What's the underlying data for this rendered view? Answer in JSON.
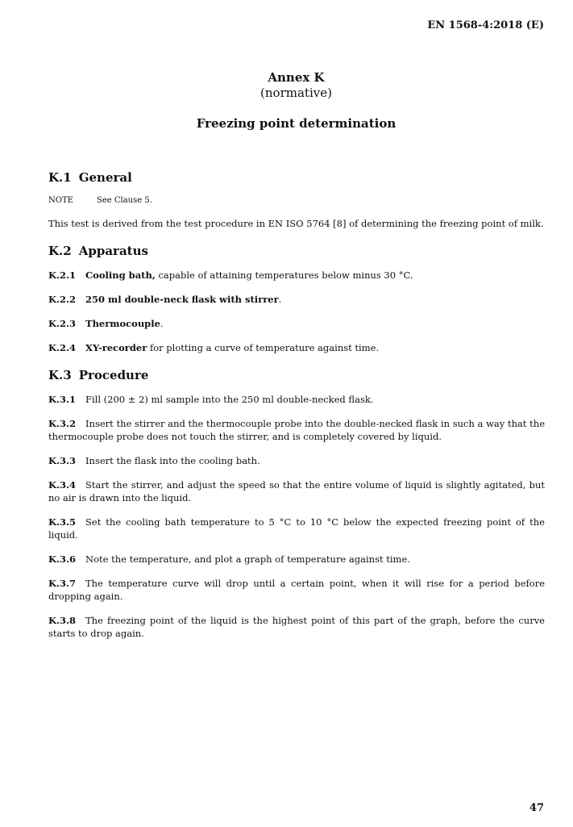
{
  "header": {
    "document_id": "EN 1568-4:2018 (E)"
  },
  "annex": {
    "title": "Annex K",
    "kind": "(normative)",
    "subject": "Freezing point determination"
  },
  "sections": {
    "general": {
      "num": "K.1",
      "title": "General",
      "note_label": "NOTE",
      "note_text": "See Clause 5.",
      "body": "This test is derived from the test procedure in EN ISO 5764 [8] of determining the freezing point of milk."
    },
    "apparatus": {
      "num": "K.2",
      "title": "Apparatus",
      "items": [
        {
          "num": "K.2.1",
          "bold": "Cooling bath,",
          "rest": " capable of attaining temperatures below minus 30 °C."
        },
        {
          "num": "K.2.2",
          "bold": "250 ml double-neck flask with stirrer",
          "rest": "."
        },
        {
          "num": "K.2.3",
          "bold": "Thermocouple",
          "rest": "."
        },
        {
          "num": "K.2.4",
          "bold": "XY-recorder",
          "rest": " for plotting a curve of temperature against time."
        }
      ]
    },
    "procedure": {
      "num": "K.3",
      "title": "Procedure",
      "items": [
        {
          "num": "K.3.1",
          "text": "Fill (200 ± 2) ml sample into the 250 ml double-necked flask."
        },
        {
          "num": "K.3.2",
          "text": "Insert the stirrer and the thermocouple probe into the double-necked flask in such a way that the thermocouple probe does not touch the stirrer, and is completely covered by liquid."
        },
        {
          "num": "K.3.3",
          "text": "Insert the flask into the cooling bath."
        },
        {
          "num": "K.3.4",
          "text": "Start the stirrer, and adjust the speed so that the entire volume of liquid is slightly agitated, but no air is drawn into the liquid."
        },
        {
          "num": "K.3.5",
          "text": "Set the cooling bath temperature to 5 °C to 10 °C below the expected freezing point of the liquid."
        },
        {
          "num": "K.3.6",
          "text": "Note the temperature, and plot a graph of temperature against time."
        },
        {
          "num": "K.3.7",
          "text": "The temperature curve will drop until a certain point, when it will rise for a period before dropping again."
        },
        {
          "num": "K.3.8",
          "text": "The freezing point of the liquid is the highest point of this part of the graph, before the curve starts to drop again."
        }
      ]
    }
  },
  "footer": {
    "page_number": "47"
  }
}
